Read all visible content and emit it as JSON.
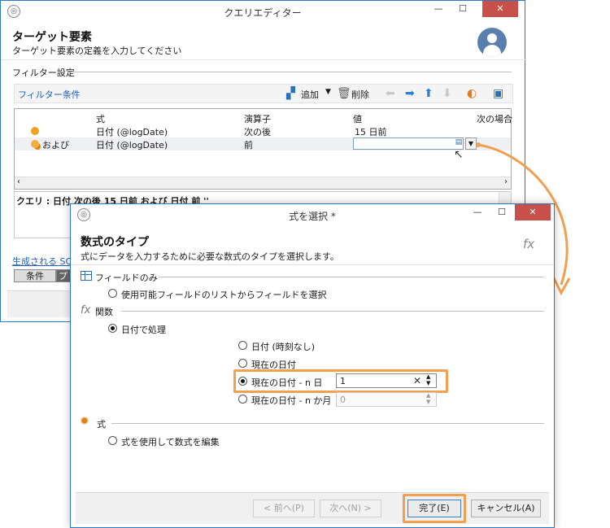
{
  "back_window": {
    "title": "クエリエディター",
    "min": "—",
    "max": "☐",
    "close": "✕",
    "header_title": "ターゲット要素",
    "header_subtitle": "ターゲット要素の定義を入力してください",
    "filter_section": "フィルター設定",
    "filter_conditions_link": "フィルター条件",
    "add_label": "追加",
    "delete_label": "削除",
    "columns": [
      "式",
      "演算子",
      "値",
      "次の場合"
    ],
    "rows": [
      {
        "prefix": "",
        "expr": "日付 (@logDate)",
        "op": "次の後",
        "value": "15 日前"
      },
      {
        "prefix": "および",
        "expr": "日付 (@logDate)",
        "op": "前",
        "value": ""
      }
    ],
    "query_text": "クエリ : 日付 次の後 15 日前 および 日付 前 ''",
    "generated_sql_link": "生成される SQL",
    "tab_conditions": "条件",
    "tab_preview": "プレ"
  },
  "dialog": {
    "title": "式を選択 *",
    "min": "—",
    "max": "☐",
    "close": "✕",
    "header_title": "数式のタイプ",
    "header_subtitle": "式にデータを入力するために必要な数式のタイプを選択します。",
    "fx": "fx",
    "section_fields": "フィールドのみ",
    "option_fields": "使用可能フィールドのリストからフィールドを選択",
    "section_functions": "関数",
    "option_date_process": "日付で処理",
    "sub_options": [
      "日付 (時刻なし)",
      "現在の日付",
      "現在の日付 - n 日",
      "現在の日付 - n か月"
    ],
    "days_value": "1",
    "months_value": "0",
    "section_expression": "式",
    "option_expression": "式を使用して数式を編集",
    "prev_button": "< 前へ(P)",
    "next_button": "次へ(N) >",
    "finish_button": "完了(E)",
    "cancel_button": "キャンセル(A)"
  },
  "colors": {
    "accent_blue": "#2b79c2",
    "highlight_orange": "#f0a050",
    "close_red": "#c7504b"
  }
}
